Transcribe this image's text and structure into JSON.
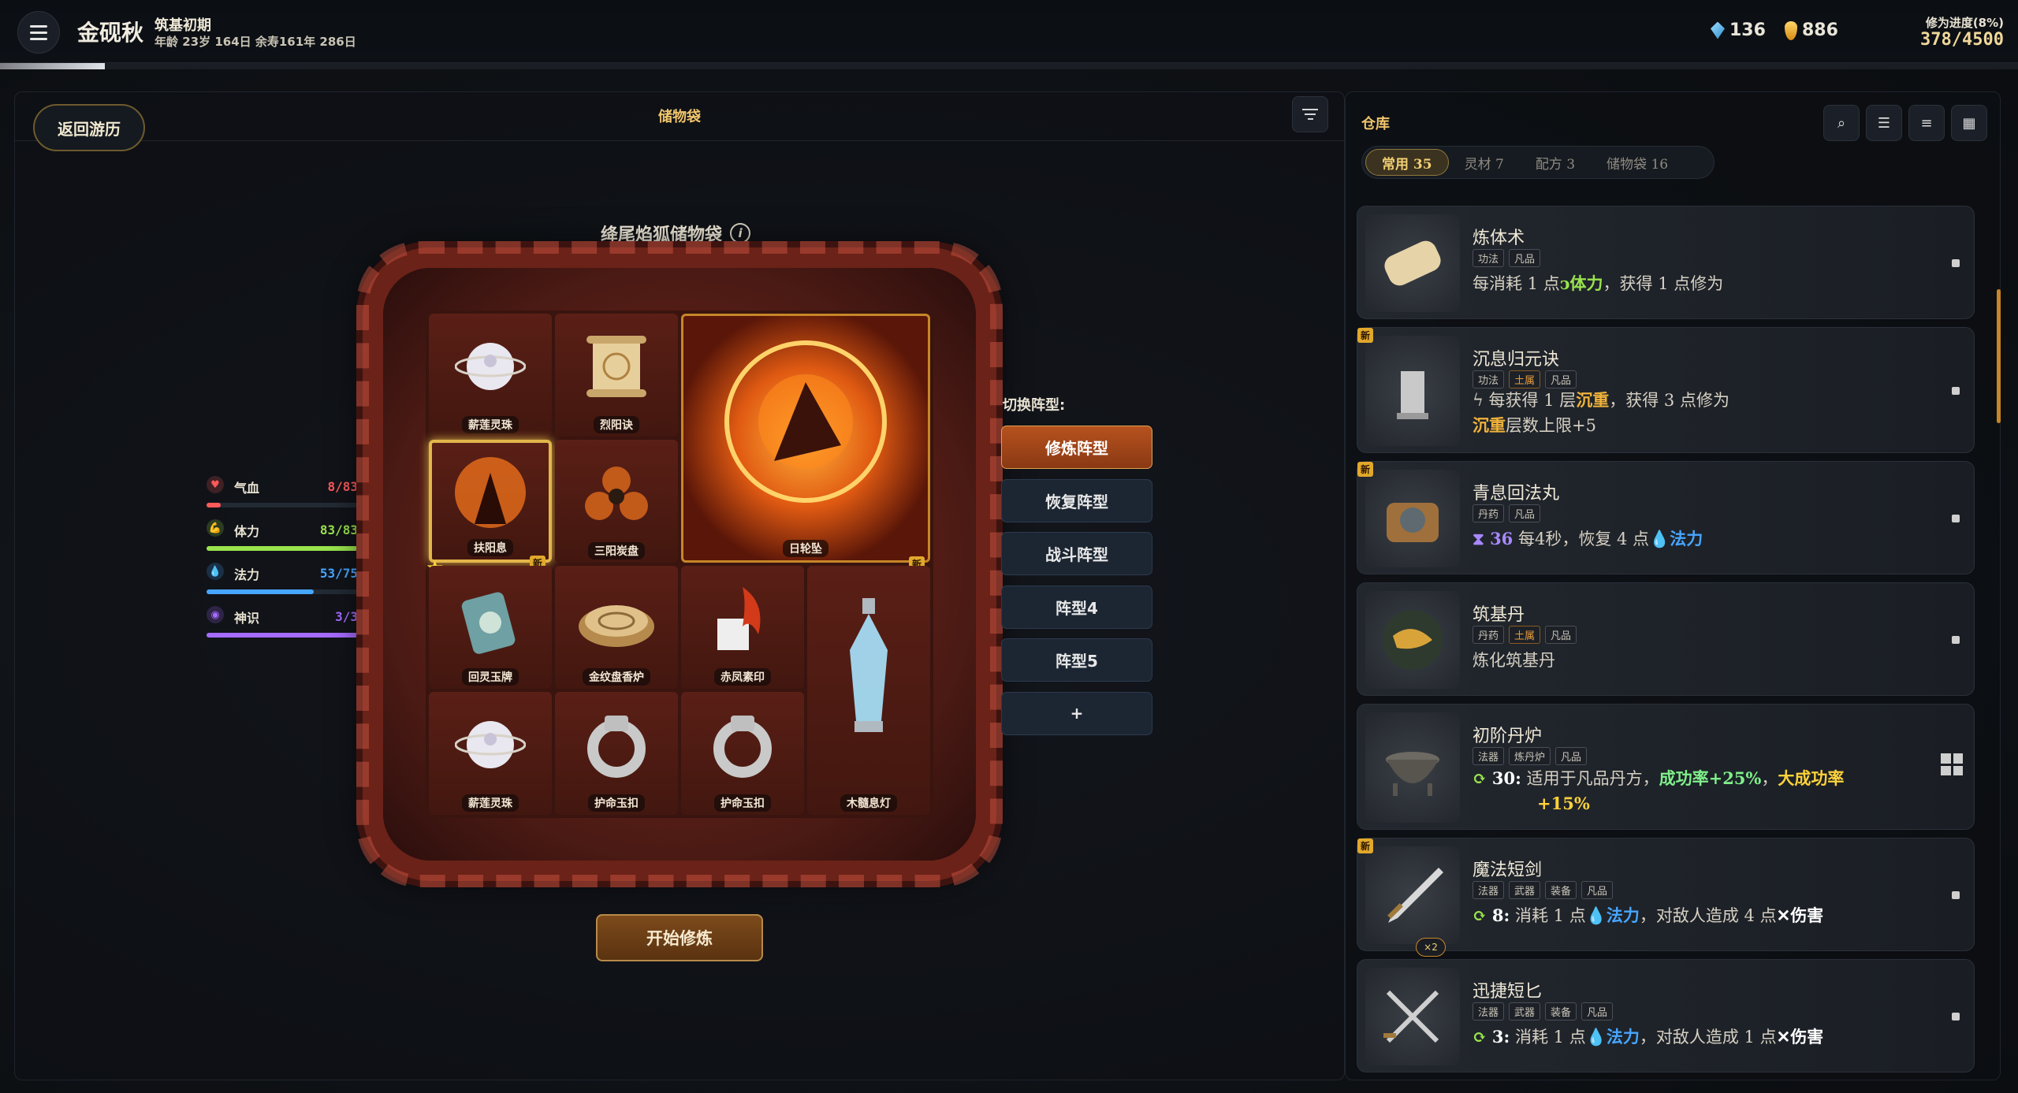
{
  "player": {
    "name": "金砚秋",
    "realm": "筑基初期",
    "age_line": "年龄 23岁 164日   余寿161年 286日"
  },
  "currency": {
    "spirit_stones": "136",
    "gold": "886"
  },
  "cultivation": {
    "label": "修为进度(8%)",
    "value": "378/4500",
    "progress_fraction": 0.08
  },
  "left": {
    "back_label": "返回游历",
    "bag_title": "储物袋",
    "bag_name": "绛尾焰狐储物袋",
    "info_icon": "i",
    "start_label": "开始修炼"
  },
  "stats": [
    {
      "name": "气血",
      "value": "8/83",
      "color": "#ff5a5a",
      "fraction": 0.096
    },
    {
      "name": "体力",
      "value": "83/83",
      "color": "#9ae34d",
      "fraction": 1.0
    },
    {
      "name": "法力",
      "value": "53/75",
      "color": "#47a6ff",
      "fraction": 0.707
    },
    {
      "name": "神识",
      "value": "3/3",
      "color": "#a66bff",
      "fraction": 1.0
    }
  ],
  "grid_items": [
    "薪莲灵珠",
    "烈阳诀",
    "日轮坠",
    "扶阳息",
    "三阳炭盘",
    "回灵玉牌",
    "金纹盘香炉",
    "赤凤素印",
    "木髓息灯",
    "薪莲灵珠",
    "护命玉扣",
    "护命玉扣"
  ],
  "new_badge": "新",
  "formation": {
    "title": "切换阵型:",
    "options": [
      "修炼阵型",
      "恢复阵型",
      "战斗阵型",
      "阵型4",
      "阵型5",
      "+"
    ],
    "active": 0
  },
  "warehouse": {
    "title": "仓库",
    "tabs": [
      {
        "label": "常用 35"
      },
      {
        "label": "灵材 7"
      },
      {
        "label": "配方 3"
      },
      {
        "label": "储物袋 16"
      }
    ],
    "active_tab": 0,
    "multiplier": "×2",
    "cards": [
      {
        "name": "炼体术",
        "tags": [
          "功法",
          "凡品"
        ],
        "new": false,
        "desc_a": "每消耗 1 点",
        "desc_b": "体力",
        "desc_c": "，获得 1 点修为"
      },
      {
        "name": "沉息归元诀",
        "tags": [
          "功法",
          "土属",
          "凡品"
        ],
        "new": true,
        "desc_a": "每获得 1 层",
        "desc_b": "沉重",
        "desc_c": "，获得 3 点修为",
        "desc_d": "沉重",
        "desc_e": "层数上限+5"
      },
      {
        "name": "青息回法丸",
        "tags": [
          "丹药",
          "凡品"
        ],
        "new": true,
        "cycle": "36",
        "desc_a": "每4秒，恢复 4 点",
        "desc_b": "法力"
      },
      {
        "name": "筑基丹",
        "tags": [
          "丹药",
          "土属",
          "凡品"
        ],
        "new": false,
        "desc_a": "炼化筑基丹"
      },
      {
        "name": "初阶丹炉",
        "tags": [
          "法器",
          "炼丹炉",
          "凡品"
        ],
        "new": false,
        "cycle": "30:",
        "desc_a": "适用于凡品丹方，",
        "desc_b": "成功率+25%",
        "desc_c": "，",
        "desc_d": "大成功率",
        "desc_e": "+15%"
      },
      {
        "name": "魔法短剑",
        "tags": [
          "法器",
          "武器",
          "装备",
          "凡品"
        ],
        "new": true,
        "cycle": "8:",
        "desc_a": "消耗 1 点",
        "desc_b": "法力",
        "desc_c": "，对敌人造成 4 点",
        "desc_d": "伤害"
      },
      {
        "name": "迅捷短匕",
        "tags": [
          "法器",
          "武器",
          "装备",
          "凡品"
        ],
        "new": false,
        "cycle": "3:",
        "desc_a": "消耗 1 点",
        "desc_b": "法力",
        "desc_c": "，对敌人造成 1 点",
        "desc_d": "伤害"
      }
    ]
  },
  "colors": {
    "accent": "#f0c46b",
    "active_formation": "#b6521e",
    "board": "#6b2218"
  }
}
